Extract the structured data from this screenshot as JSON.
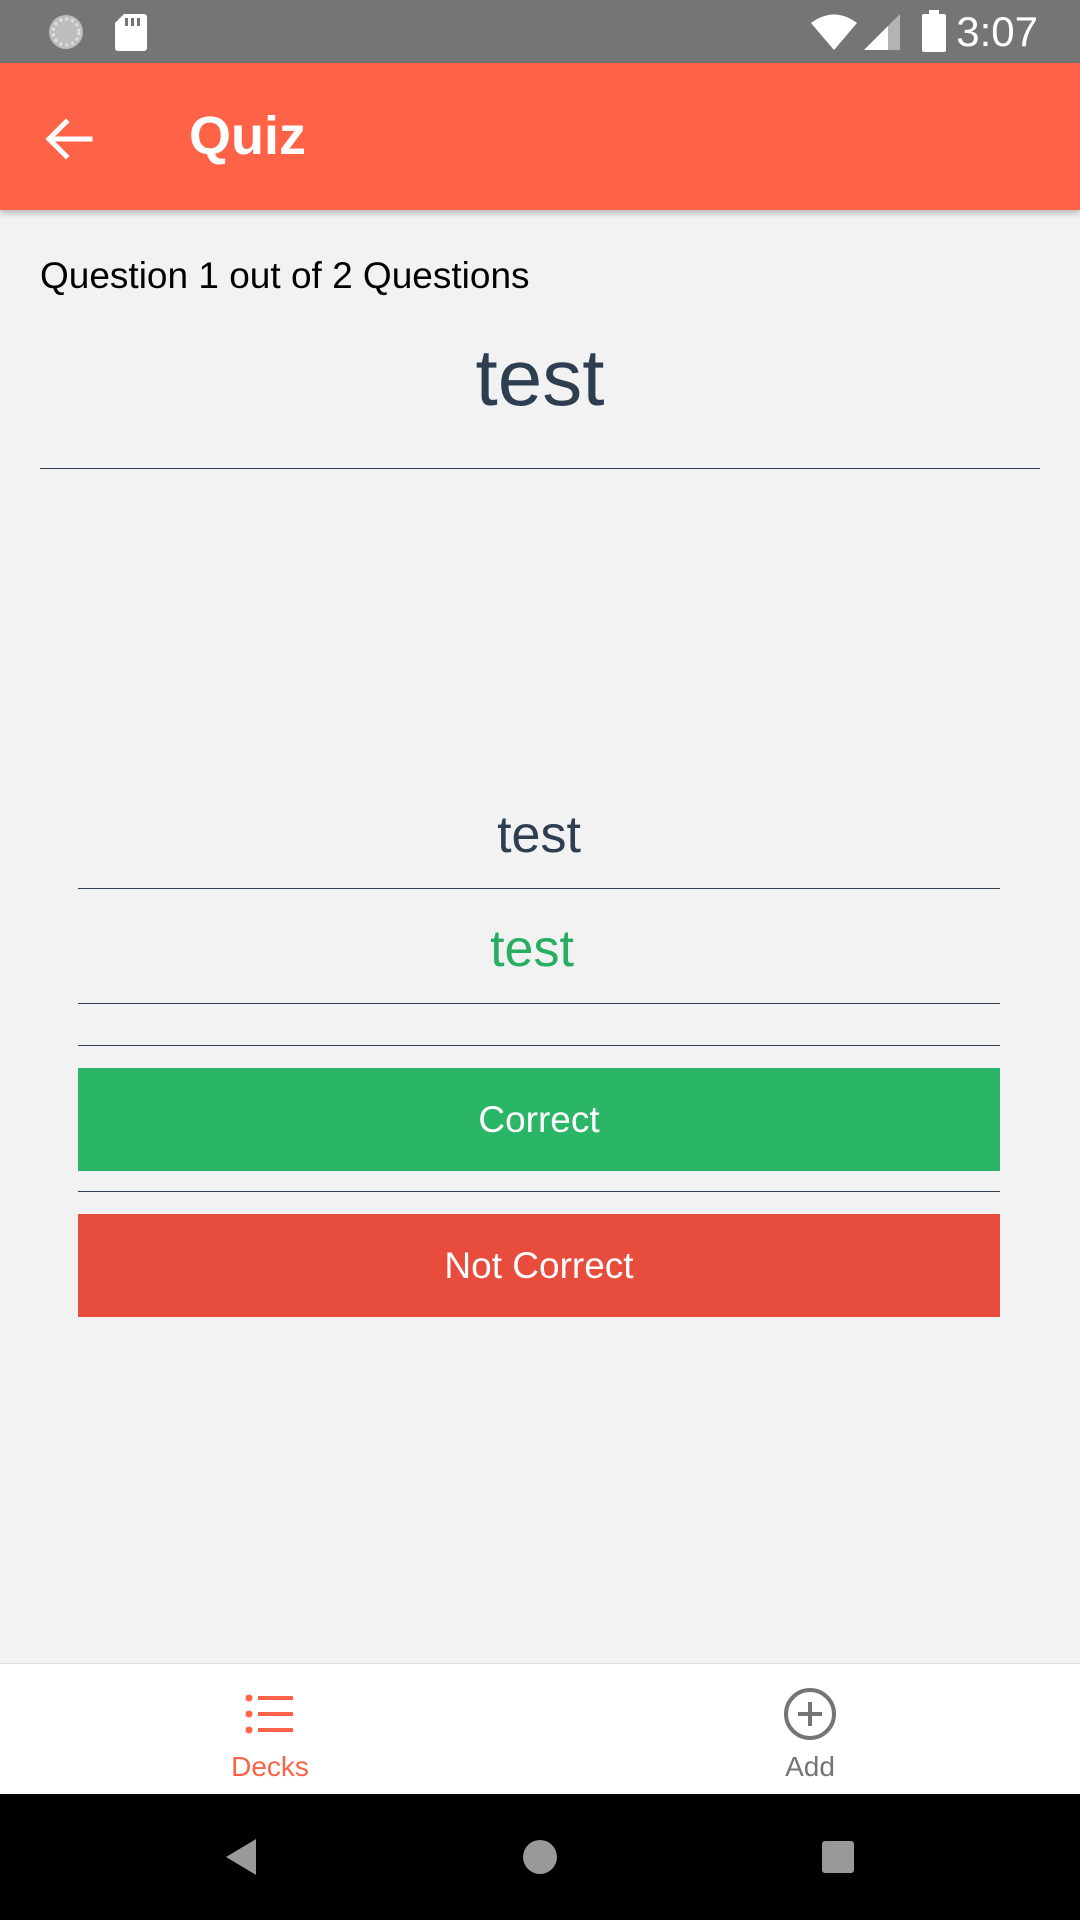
{
  "status_bar": {
    "time": "3:07",
    "icons": [
      "loading-icon",
      "sd-card-icon",
      "wifi-icon",
      "signal-icon",
      "battery-icon"
    ]
  },
  "app_bar": {
    "title": "Quiz",
    "back_icon": "arrow-back-icon",
    "color": "#ff6347"
  },
  "quiz": {
    "progress": "Question 1 out of 2 Questions",
    "question": "test",
    "answer_input_value": "test",
    "answer_reveal": "test",
    "correct_label": "Correct",
    "incorrect_label": "Not Correct",
    "correct_color": "#2bb566",
    "incorrect_color": "#e84c3d",
    "reveal_color": "#27ae60"
  },
  "bottom_nav": {
    "items": [
      {
        "label": "Decks",
        "icon": "list-icon",
        "active": true,
        "color": "#ff6347"
      },
      {
        "label": "Add",
        "icon": "add-circle-icon",
        "active": false,
        "color": "#757575"
      }
    ]
  },
  "system_nav": {
    "icons": [
      "back-triangle-icon",
      "home-circle-icon",
      "recents-square-icon"
    ]
  }
}
